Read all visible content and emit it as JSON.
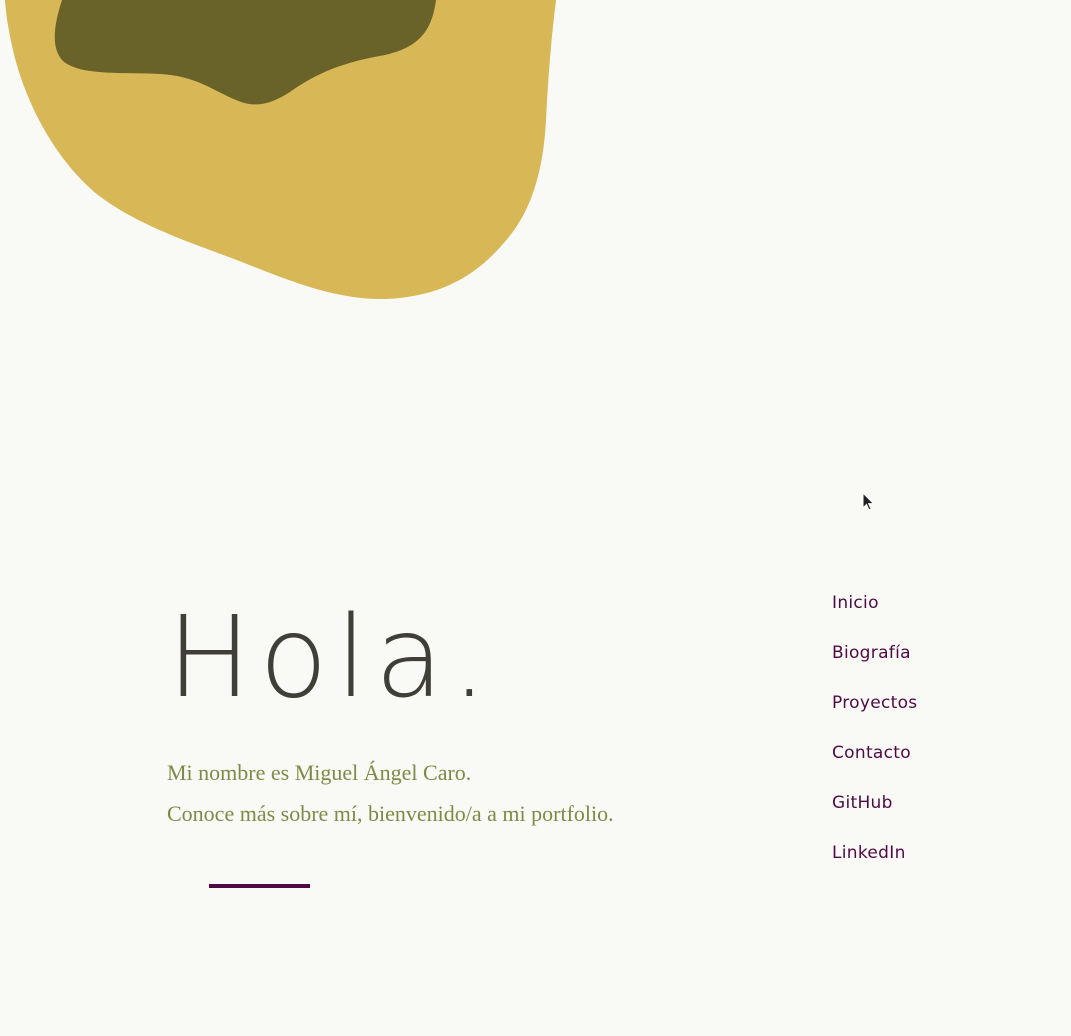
{
  "colors": {
    "background": "#f9f9f6",
    "blob_outer": "#d8b757",
    "blob_inner": "#6a6329",
    "title": "#3f3f38",
    "intro_text": "#7f8a46",
    "accent": "#4f0a43"
  },
  "hero": {
    "title": "Hola.",
    "line_one": "Mi nombre es Miguel Ángel Caro.",
    "line_two": "Conoce más sobre mí, bienvenido/a a mi portfolio."
  },
  "nav": {
    "items": [
      {
        "label": "Inicio"
      },
      {
        "label": "Biografía"
      },
      {
        "label": "Proyectos"
      },
      {
        "label": "Contacto"
      },
      {
        "label": "GitHub"
      },
      {
        "label": "LinkedIn"
      }
    ]
  },
  "cursor": {
    "icon": "pointer-arrow-icon"
  }
}
